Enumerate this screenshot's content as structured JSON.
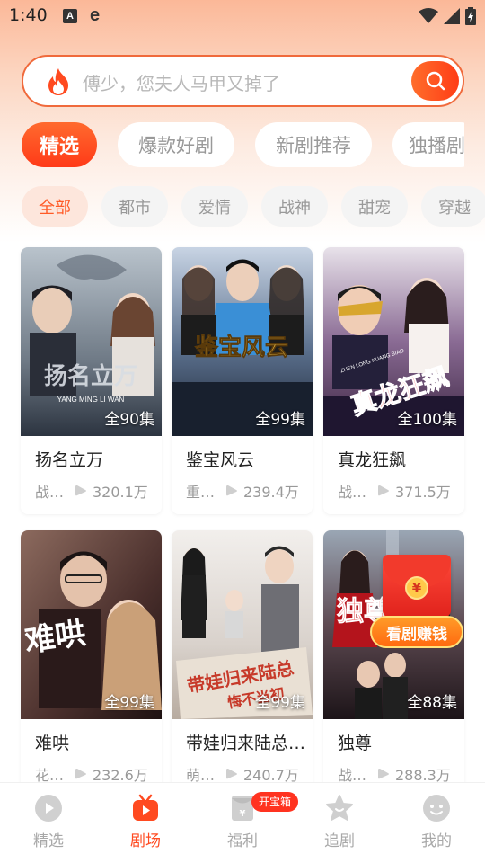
{
  "status_bar": {
    "time": "1:40",
    "icon_a": "A",
    "icon_e": "e"
  },
  "search": {
    "placeholder": "傅少，您夫人马甲又掉了"
  },
  "category_tabs": [
    {
      "label": "精选",
      "active": true
    },
    {
      "label": "爆款好剧",
      "active": false
    },
    {
      "label": "新剧推荐",
      "active": false
    },
    {
      "label": "独播剧",
      "active": false
    }
  ],
  "genre_chips": [
    {
      "label": "全部",
      "active": true
    },
    {
      "label": "都市",
      "active": false
    },
    {
      "label": "爱情",
      "active": false
    },
    {
      "label": "战神",
      "active": false
    },
    {
      "label": "甜宠",
      "active": false
    },
    {
      "label": "穿越",
      "active": false
    }
  ],
  "dramas": [
    {
      "title": "扬名立万",
      "episodes": "全90集",
      "tag": "战…",
      "views": "320.1万",
      "poster_title": "扬名立万",
      "poster_subtitle": "YANG MING LI WAN"
    },
    {
      "title": "鉴宝风云",
      "episodes": "全99集",
      "tag": "重…",
      "views": "239.4万",
      "poster_title": "鉴宝风云"
    },
    {
      "title": "真龙狂飙",
      "episodes": "全100集",
      "tag": "战…",
      "views": "371.5万",
      "poster_title": "真龙狂飙",
      "poster_subtitle": "ZHEN LONG KUANG BIAO"
    },
    {
      "title": "难哄",
      "episodes": "全99集",
      "tag": "花…",
      "views": "232.6万",
      "poster_title": "难哄"
    },
    {
      "title": "带娃归来陆总…",
      "episodes": "全99集",
      "tag": "萌…",
      "views": "240.7万",
      "poster_title": "带娃归来陆总",
      "poster_subtitle": "悔不当初"
    },
    {
      "title": "独尊",
      "episodes": "全88集",
      "tag": "战…",
      "views": "288.3万",
      "poster_title": "独尊"
    }
  ],
  "reward": {
    "label": "看剧赚钱",
    "coin": "¥"
  },
  "bottom_nav": [
    {
      "label": "精选",
      "icon": "play-circle-icon",
      "active": false
    },
    {
      "label": "剧场",
      "icon": "tv-play-icon",
      "active": true
    },
    {
      "label": "福利",
      "icon": "red-packet-icon",
      "active": false,
      "badge": "开宝箱"
    },
    {
      "label": "追剧",
      "icon": "star-icon",
      "active": false
    },
    {
      "label": "我的",
      "icon": "smiley-face-icon",
      "active": false
    }
  ],
  "colors": {
    "accent": "#ff4a20",
    "accent_gradient_end": "#ff3a18",
    "chip_active_bg": "#fde6dc"
  }
}
